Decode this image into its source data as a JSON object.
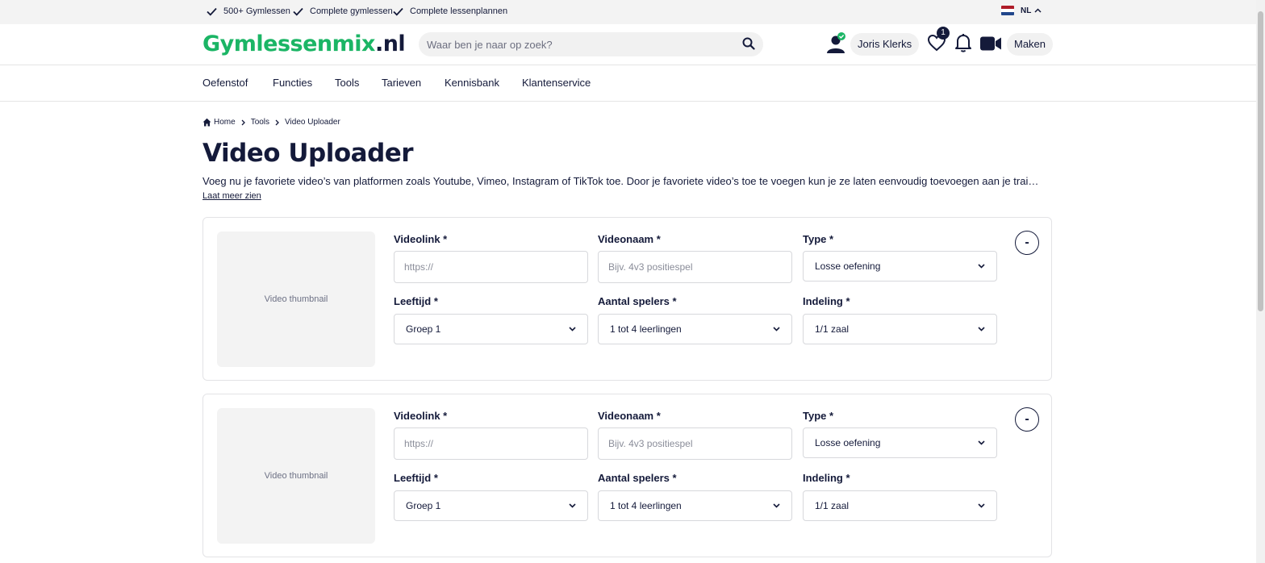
{
  "topbar": {
    "usps": [
      "500+ Gymlessen",
      "Complete gymlessen",
      "Complete lessenplannen"
    ],
    "language": "NL"
  },
  "header": {
    "logo_main": "Gymlessenmix",
    "logo_tld": ".nl",
    "search_placeholder": "Waar ben je naar op zoek?",
    "user_name": "Joris Klerks",
    "favorites_count": "1",
    "create_label": "Maken"
  },
  "nav": {
    "items": [
      "Oefenstof",
      "Functies",
      "Tools",
      "Tarieven",
      "Kennisbank",
      "Klantenservice"
    ]
  },
  "breadcrumb": [
    "Home",
    "Tools",
    "Video Uploader"
  ],
  "page": {
    "title": "Video Uploader",
    "description": "Voeg nu je favoriete video’s van platformen zoals Youtube, Vimeo, Instagram of TikTok toe. Door je favoriete video’s toe te voegen kun je ze laten eenvoudig toevoegen aan je trainingen en lessen.",
    "more_label": "Laat meer zien"
  },
  "form": {
    "thumbnail_label": "Video thumbnail",
    "remove_label": "-",
    "labels": {
      "videolink": "Videolink *",
      "videonaam": "Videonaam *",
      "type": "Type *",
      "leeftijd": "Leeftijd *",
      "spelers": "Aantal spelers *",
      "indeling": "Indeling *"
    },
    "placeholders": {
      "videolink": "https://",
      "videonaam": "Bijv. 4v3 positiespel"
    },
    "values": {
      "type": "Losse oefening",
      "leeftijd": "Groep 1",
      "spelers": "1 tot 4 leerlingen",
      "indeling": "1/1 zaal"
    }
  },
  "colors": {
    "brand_green": "#1bb565",
    "navy": "#141a3a"
  }
}
